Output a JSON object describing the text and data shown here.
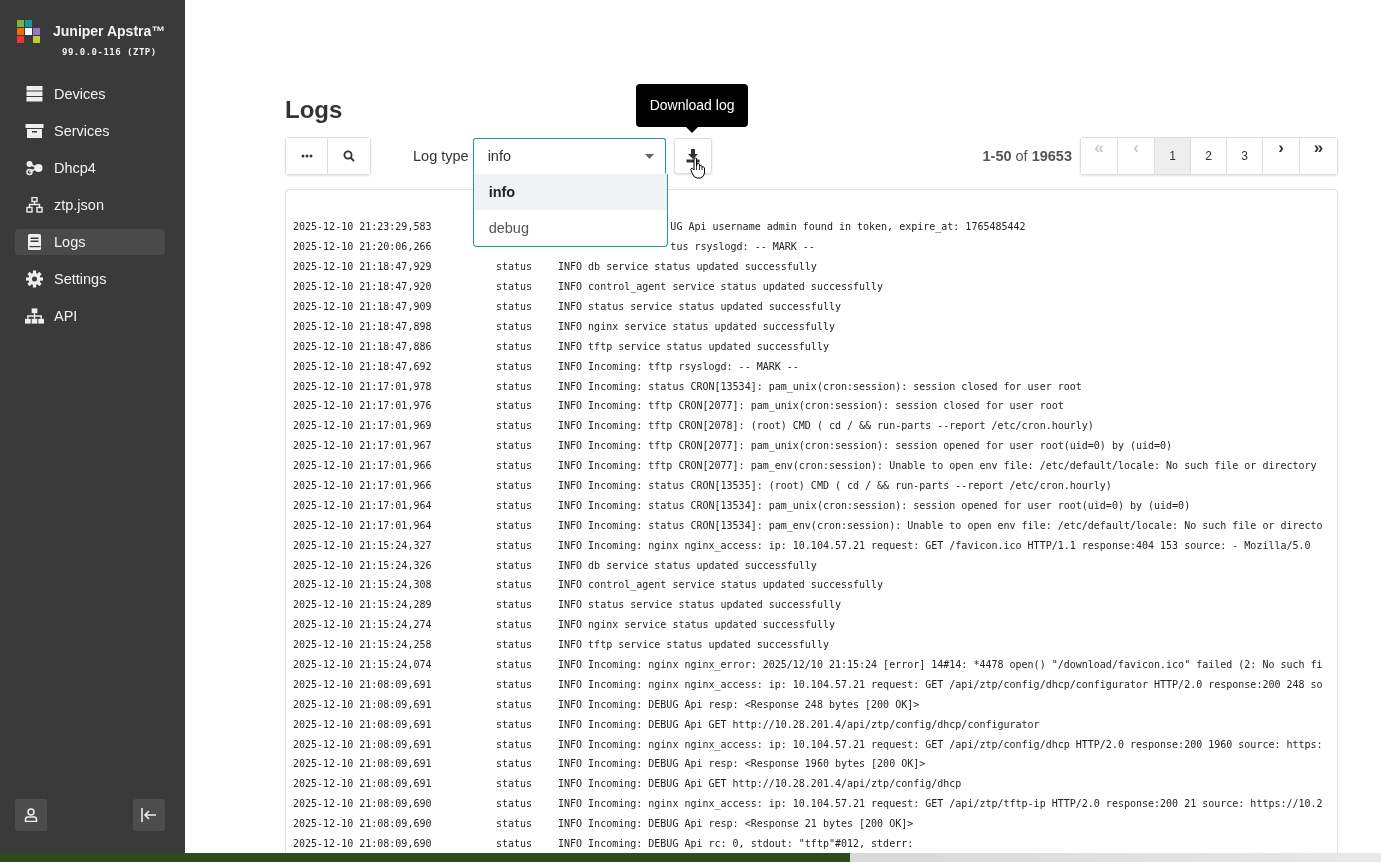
{
  "sidebar": {
    "brand": "Juniper Apstra™",
    "version": "99.0.0-116 (ZTP)",
    "items": [
      {
        "label": "Devices",
        "kind": "server",
        "selected": false
      },
      {
        "label": "Services",
        "kind": "archive",
        "selected": false
      },
      {
        "label": "Dhcp4",
        "kind": "nodes",
        "selected": false
      },
      {
        "label": "ztp.json",
        "kind": "sitemap",
        "selected": false
      },
      {
        "label": "Logs",
        "kind": "book",
        "selected": true
      },
      {
        "label": "Settings",
        "kind": "gear",
        "selected": false
      },
      {
        "label": "API",
        "kind": "network",
        "selected": false
      }
    ]
  },
  "page": {
    "title": "Logs"
  },
  "toolbar": {
    "log_type_label": "Log type",
    "log_type": {
      "value": "info",
      "expanded": true,
      "options": [
        {
          "label": "info",
          "selected": true
        },
        {
          "label": "debug",
          "selected": false
        }
      ]
    },
    "tooltip": "Download log",
    "range": "**1-50** of **19653**",
    "pages": [
      {
        "label": "«",
        "kind": "nav",
        "disabled": true,
        "selected": false
      },
      {
        "label": "‹",
        "kind": "nav",
        "disabled": true,
        "selected": false
      },
      {
        "label": "1",
        "kind": "page",
        "disabled": false,
        "selected": true
      },
      {
        "label": "2",
        "kind": "page",
        "disabled": false,
        "selected": false
      },
      {
        "label": "3",
        "kind": "page",
        "disabled": false,
        "selected": false
      },
      {
        "label": "›",
        "kind": "nav",
        "disabled": false,
        "selected": false
      },
      {
        "label": "»",
        "kind": "nav",
        "disabled": false,
        "selected": false
      }
    ]
  },
  "log": [
    {
      "kind": "covered",
      "timestamp": "2025-12-10 21:23:29,583",
      "message": "UG Api username admin found in token, expire_at: 1765485442"
    },
    {
      "kind": "covered",
      "timestamp": "2025-12-10 21:20:06,266",
      "message": "tus rsyslogd: -- MARK --"
    },
    {
      "kind": "full",
      "timestamp": "2025-12-10 21:18:47,929",
      "source": "status",
      "message": "INFO db service status updated successfully"
    },
    {
      "kind": "full",
      "timestamp": "2025-12-10 21:18:47,920",
      "source": "status",
      "message": "INFO control_agent service status updated successfully"
    },
    {
      "kind": "full",
      "timestamp": "2025-12-10 21:18:47,909",
      "source": "status",
      "message": "INFO status service status updated successfully"
    },
    {
      "kind": "full",
      "timestamp": "2025-12-10 21:18:47,898",
      "source": "status",
      "message": "INFO nginx service status updated successfully"
    },
    {
      "kind": "full",
      "timestamp": "2025-12-10 21:18:47,886",
      "source": "status",
      "message": "INFO tftp service status updated successfully"
    },
    {
      "kind": "full",
      "timestamp": "2025-12-10 21:18:47,692",
      "source": "status",
      "message": "INFO Incoming: tftp rsyslogd: -- MARK --"
    },
    {
      "kind": "full",
      "timestamp": "2025-12-10 21:17:01,978",
      "source": "status",
      "message": "INFO Incoming: status CRON[13534]: pam_unix(cron:session): session closed for user root"
    },
    {
      "kind": "full",
      "timestamp": "2025-12-10 21:17:01,976",
      "source": "status",
      "message": "INFO Incoming: tftp CRON[2077]: pam_unix(cron:session): session closed for user root"
    },
    {
      "kind": "full",
      "timestamp": "2025-12-10 21:17:01,969",
      "source": "status",
      "message": "INFO Incoming: tftp CRON[2078]: (root) CMD (   cd / && run-parts --report /etc/cron.hourly)"
    },
    {
      "kind": "full",
      "timestamp": "2025-12-10 21:17:01,967",
      "source": "status",
      "message": "INFO Incoming: tftp CRON[2077]: pam_unix(cron:session): session opened for user root(uid=0) by (uid=0)"
    },
    {
      "kind": "full",
      "timestamp": "2025-12-10 21:17:01,966",
      "source": "status",
      "message": "INFO Incoming: tftp CRON[2077]: pam_env(cron:session): Unable to open env file: /etc/default/locale: No such file or directory"
    },
    {
      "kind": "full",
      "timestamp": "2025-12-10 21:17:01,966",
      "source": "status",
      "message": "INFO Incoming: status CRON[13535]: (root) CMD (   cd / && run-parts --report /etc/cron.hourly)"
    },
    {
      "kind": "full",
      "timestamp": "2025-12-10 21:17:01,964",
      "source": "status",
      "message": "INFO Incoming: status CRON[13534]: pam_unix(cron:session): session opened for user root(uid=0) by (uid=0)"
    },
    {
      "kind": "full",
      "timestamp": "2025-12-10 21:17:01,964",
      "source": "status",
      "message": "INFO Incoming: status CRON[13534]: pam_env(cron:session): Unable to open env file: /etc/default/locale: No such file or directo"
    },
    {
      "kind": "full",
      "timestamp": "2025-12-10 21:15:24,327",
      "source": "status",
      "message": "INFO Incoming: nginx nginx_access: ip: 10.104.57.21 request: GET /favicon.ico HTTP/1.1 response:404 153 source: - Mozilla/5.0"
    },
    {
      "kind": "full",
      "timestamp": "2025-12-10 21:15:24,326",
      "source": "status",
      "message": "INFO db service status updated successfully"
    },
    {
      "kind": "full",
      "timestamp": "2025-12-10 21:15:24,308",
      "source": "status",
      "message": "INFO control_agent service status updated successfully"
    },
    {
      "kind": "full",
      "timestamp": "2025-12-10 21:15:24,289",
      "source": "status",
      "message": "INFO status service status updated successfully"
    },
    {
      "kind": "full",
      "timestamp": "2025-12-10 21:15:24,274",
      "source": "status",
      "message": "INFO nginx service status updated successfully"
    },
    {
      "kind": "full",
      "timestamp": "2025-12-10 21:15:24,258",
      "source": "status",
      "message": "INFO tftp service status updated successfully"
    },
    {
      "kind": "full",
      "timestamp": "2025-12-10 21:15:24,074",
      "source": "status",
      "message": "INFO Incoming: nginx nginx_error: 2025/12/10 21:15:24 [error] 14#14: *4478 open() \"/download/favicon.ico\" failed (2: No such fi"
    },
    {
      "kind": "full",
      "timestamp": "2025-12-10 21:08:09,691",
      "source": "status",
      "message": "INFO Incoming: nginx nginx_access: ip: 10.104.57.21 request: GET /api/ztp/config/dhcp/configurator HTTP/2.0 response:200 248 so"
    },
    {
      "kind": "full",
      "timestamp": "2025-12-10 21:08:09,691",
      "source": "status",
      "message": "INFO Incoming: DEBUG Api resp: <Response 248 bytes [200 OK]>"
    },
    {
      "kind": "full",
      "timestamp": "2025-12-10 21:08:09,691",
      "source": "status",
      "message": "INFO Incoming: DEBUG Api GET http://10.28.201.4/api/ztp/config/dhcp/configurator"
    },
    {
      "kind": "full",
      "timestamp": "2025-12-10 21:08:09,691",
      "source": "status",
      "message": "INFO Incoming: nginx nginx_access: ip: 10.104.57.21 request: GET /api/ztp/config/dhcp HTTP/2.0 response:200 1960 source: https:"
    },
    {
      "kind": "full",
      "timestamp": "2025-12-10 21:08:09,691",
      "source": "status",
      "message": "INFO Incoming: DEBUG Api resp: <Response 1960 bytes [200 OK]>"
    },
    {
      "kind": "full",
      "timestamp": "2025-12-10 21:08:09,691",
      "source": "status",
      "message": "INFO Incoming: DEBUG Api GET http://10.28.201.4/api/ztp/config/dhcp"
    },
    {
      "kind": "full",
      "timestamp": "2025-12-10 21:08:09,690",
      "source": "status",
      "message": "INFO Incoming: nginx nginx_access: ip: 10.104.57.21 request: GET /api/ztp/tftp-ip HTTP/2.0 response:200 21 source: https://10.2"
    },
    {
      "kind": "full",
      "timestamp": "2025-12-10 21:08:09,690",
      "source": "status",
      "message": "INFO Incoming: DEBUG Api resp: <Response 21 bytes [200 OK]>"
    },
    {
      "kind": "full",
      "timestamp": "2025-12-10 21:08:09,690",
      "source": "status",
      "message": "INFO Incoming: DEBUG Api rc: 0, stdout: \"tftp\"#012, stderr:"
    }
  ]
}
